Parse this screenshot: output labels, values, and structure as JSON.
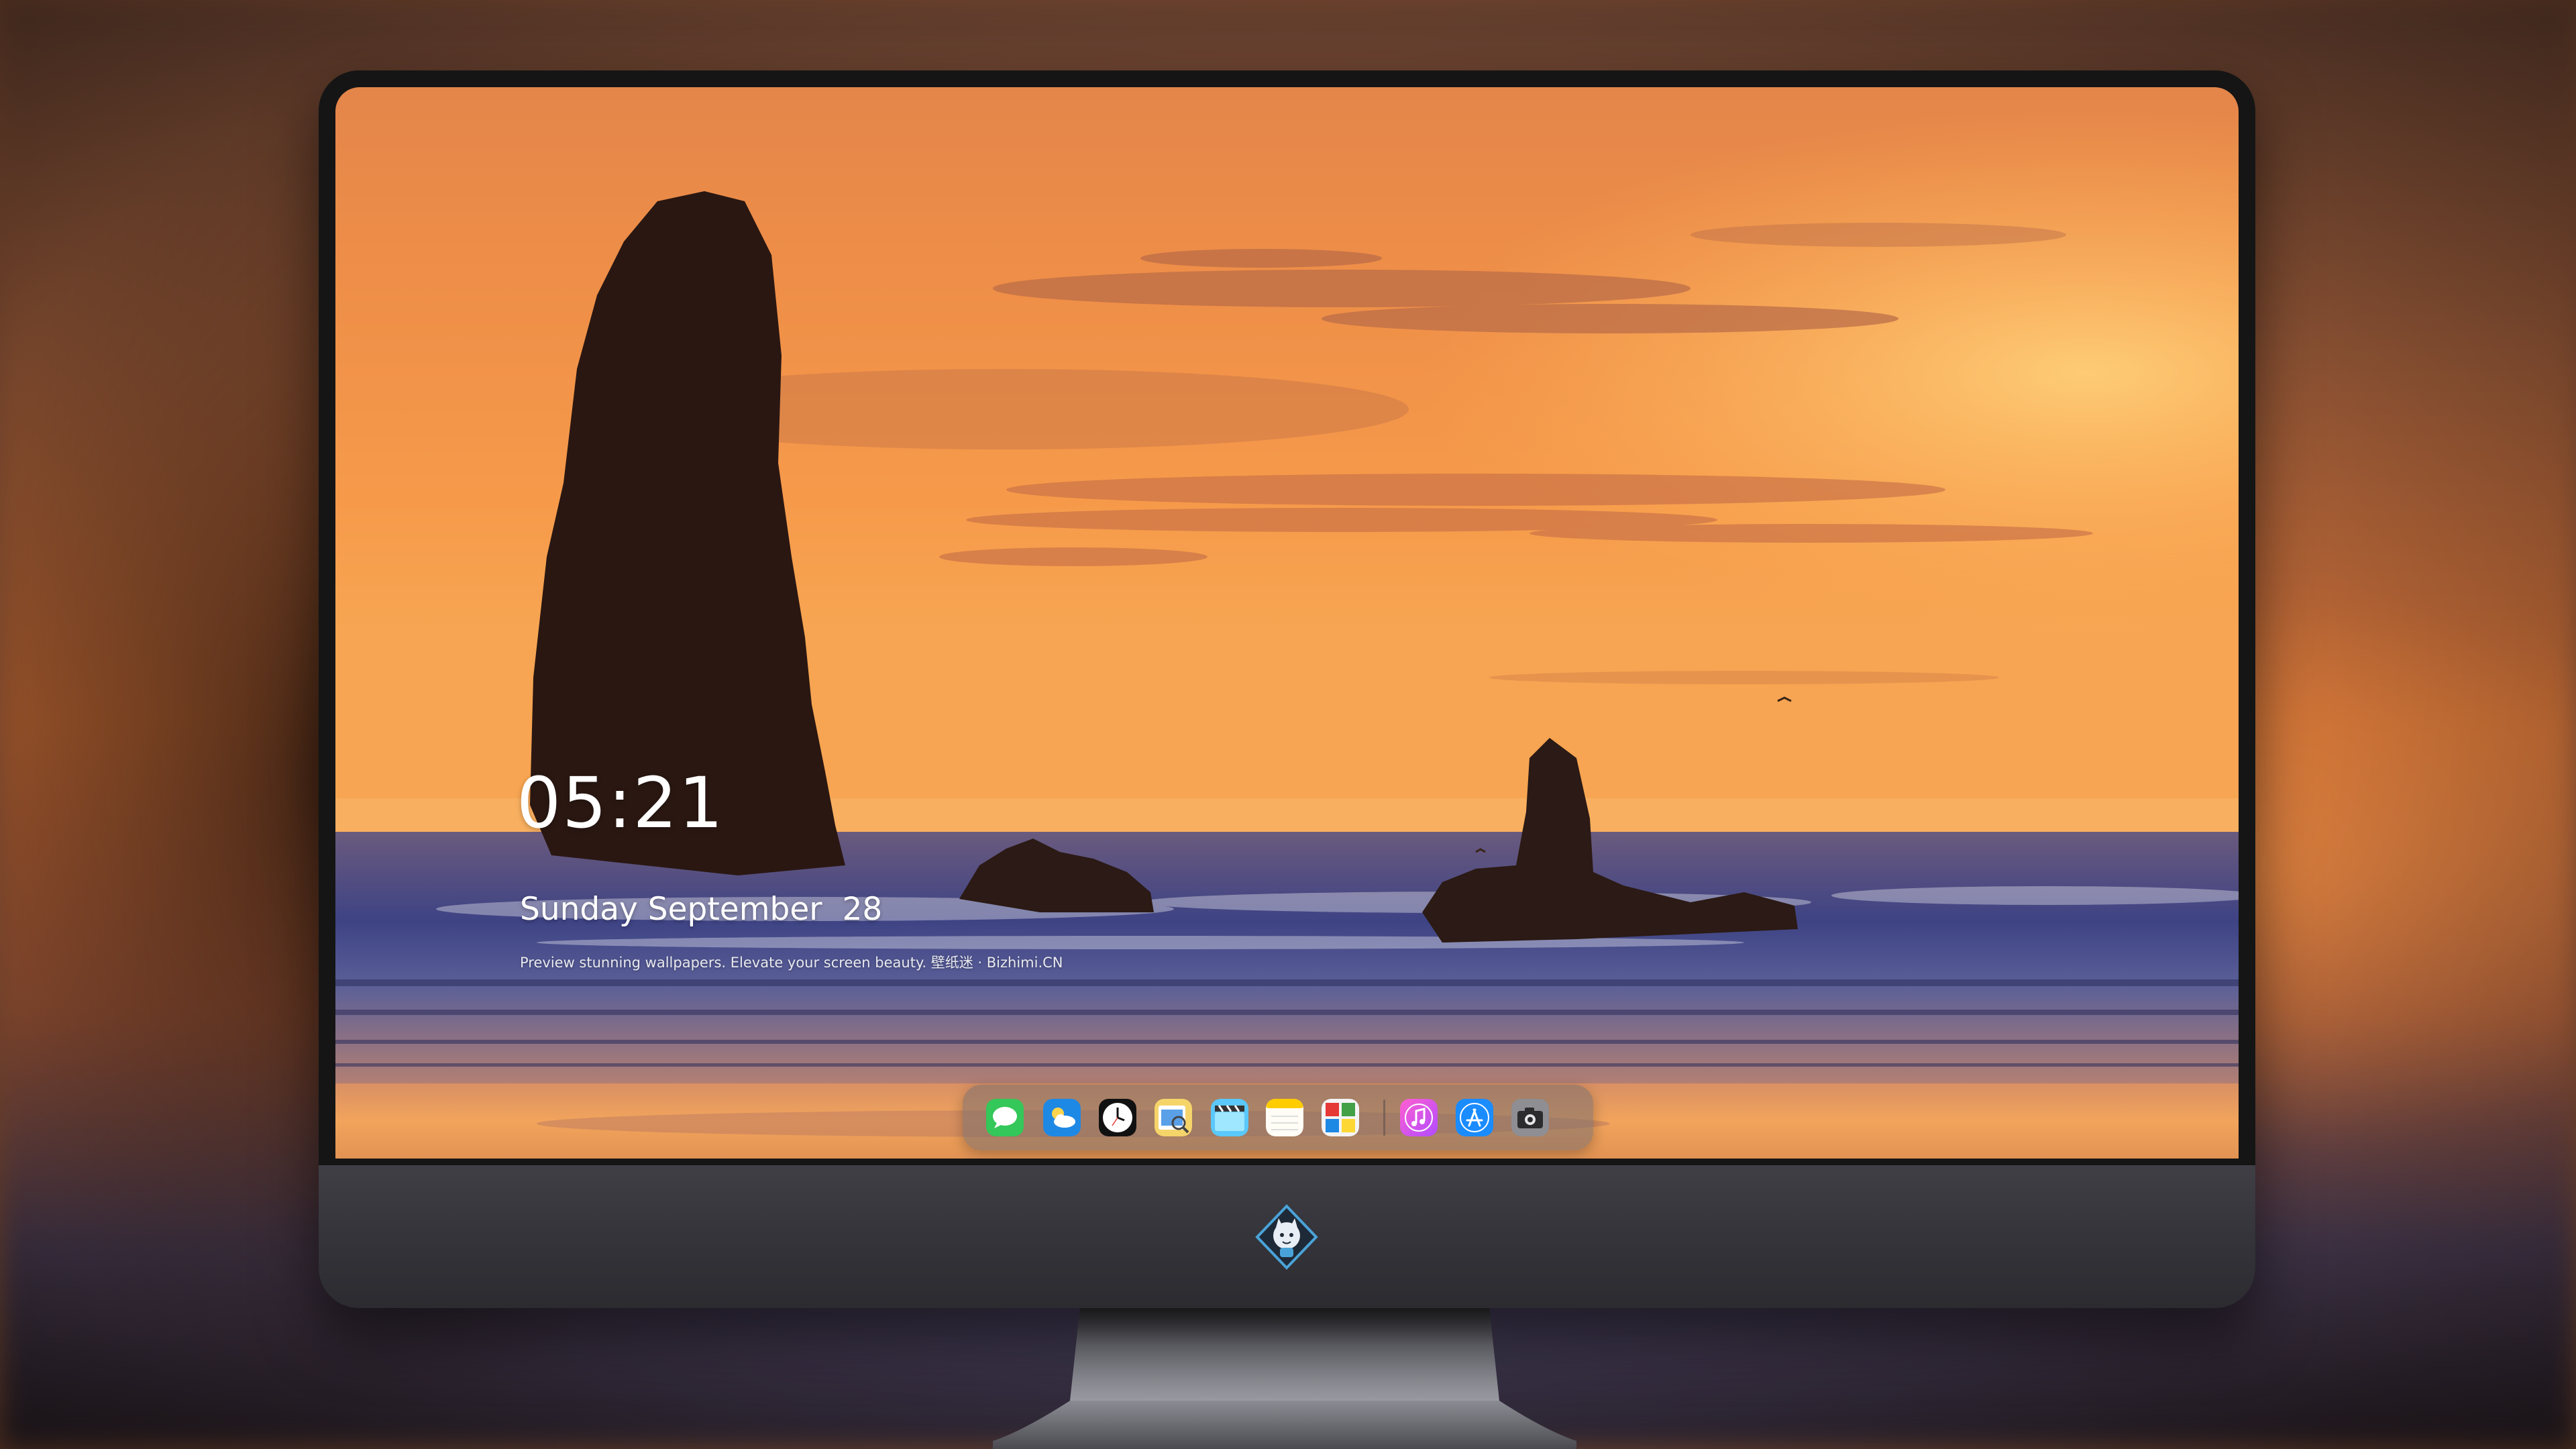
{
  "lock_screen": {
    "time": "05:21",
    "date": "Sunday September  28",
    "tagline": "Preview stunning wallpapers. Elevate your screen beauty. 壁纸迷 · Bizhimi.CN"
  },
  "dock": {
    "apps": [
      {
        "name": "messages-icon"
      },
      {
        "name": "weather-icon"
      },
      {
        "name": "clock-icon"
      },
      {
        "name": "preview-icon"
      },
      {
        "name": "video-clapper-icon"
      },
      {
        "name": "notes-icon"
      },
      {
        "name": "photo-booth-icon"
      },
      {
        "name": "itunes-icon"
      },
      {
        "name": "app-store-icon"
      },
      {
        "name": "camera-icon"
      }
    ]
  },
  "colors": {
    "sky_top": "#e78a44",
    "sky_mid": "#f69848",
    "horizon": "#fbae58",
    "sea": "#4f5290",
    "sand": "#e9a060",
    "bezel": "#151515",
    "chin": "#36363b"
  }
}
